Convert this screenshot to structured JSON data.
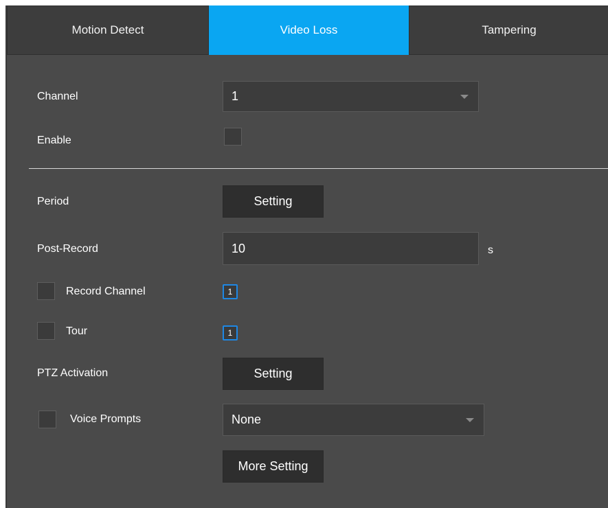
{
  "tabs": [
    {
      "label": "Motion Detect",
      "active": false
    },
    {
      "label": "Video Loss",
      "active": true
    },
    {
      "label": "Tampering",
      "active": false
    }
  ],
  "form": {
    "channel": {
      "label": "Channel",
      "value": "1"
    },
    "enable": {
      "label": "Enable",
      "checked": false
    },
    "period": {
      "label": "Period",
      "button": "Setting"
    },
    "post_record": {
      "label": "Post-Record",
      "value": "10",
      "unit": "s"
    },
    "record_channel": {
      "label": "Record Channel",
      "checked": false,
      "chip": "1"
    },
    "tour": {
      "label": "Tour",
      "checked": false,
      "chip": "1"
    },
    "ptz_activation": {
      "label": "PTZ Activation",
      "button": "Setting"
    },
    "voice_prompts": {
      "label": "Voice Prompts",
      "checked": false,
      "value": "None"
    },
    "more_setting": {
      "label": "More Setting"
    }
  },
  "colors": {
    "accent": "#0aa6f2",
    "panel": "#4a4a4a",
    "chip_border": "#1e88e5"
  }
}
